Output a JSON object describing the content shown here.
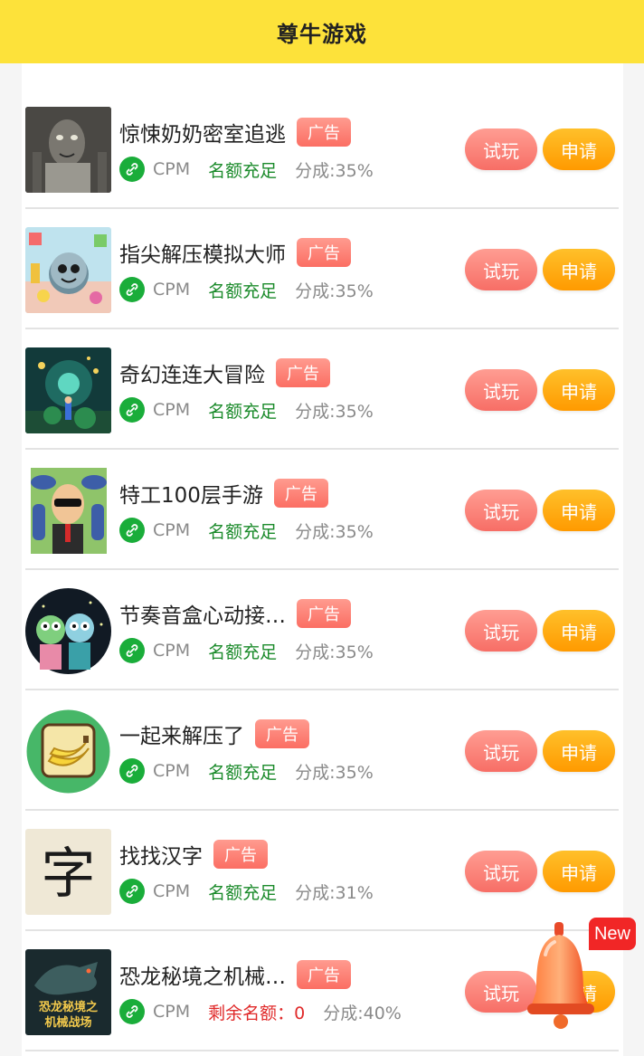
{
  "header": {
    "title": "尊牛游戏"
  },
  "rows": [
    {
      "name": "惊悚奶奶密室追逃",
      "ad": "广告",
      "cpm": "CPM",
      "quota": "名额充足",
      "share": "分成:35%",
      "try": "试玩",
      "apply": "申请"
    },
    {
      "name": "指尖解压模拟大师",
      "ad": "广告",
      "cpm": "CPM",
      "quota": "名额充足",
      "share": "分成:35%",
      "try": "试玩",
      "apply": "申请"
    },
    {
      "name": "奇幻连连大冒险",
      "ad": "广告",
      "cpm": "CPM",
      "quota": "名额充足",
      "share": "分成:35%",
      "try": "试玩",
      "apply": "申请"
    },
    {
      "name": "特工100层手游",
      "ad": "广告",
      "cpm": "CPM",
      "quota": "名额充足",
      "share": "分成:35%",
      "try": "试玩",
      "apply": "申请"
    },
    {
      "name": "节奏音盒心动接…",
      "ad": "广告",
      "cpm": "CPM",
      "quota": "名额充足",
      "share": "分成:35%",
      "try": "试玩",
      "apply": "申请"
    },
    {
      "name": "一起来解压了",
      "ad": "广告",
      "cpm": "CPM",
      "quota": "名额充足",
      "share": "分成:35%",
      "try": "试玩",
      "apply": "申请"
    },
    {
      "name": "找找汉字",
      "ad": "广告",
      "cpm": "CPM",
      "quota": "名额充足",
      "share": "分成:31%",
      "try": "试玩",
      "apply": "申请",
      "thumb_char": "字"
    },
    {
      "name": "恐龙秘境之机械…",
      "ad": "广告",
      "cpm": "CPM",
      "quota": "剩余名额：0",
      "share": "分成:40%",
      "try": "试玩",
      "apply": "申请",
      "thumb_text_1": "恐龙秘境之",
      "thumb_text_2": "机械战场"
    }
  ],
  "floating": {
    "badge": "New",
    "icon": "bell-icon"
  },
  "colors": {
    "header_bg": "#fde23a",
    "ad_tag": "#fb6e63",
    "try_button": "#f76e66",
    "apply_button": "#ff9a00",
    "quota_ok": "#1a8a2a",
    "quota_low": "#e02a2a",
    "link_icon": "#1aad3a"
  }
}
